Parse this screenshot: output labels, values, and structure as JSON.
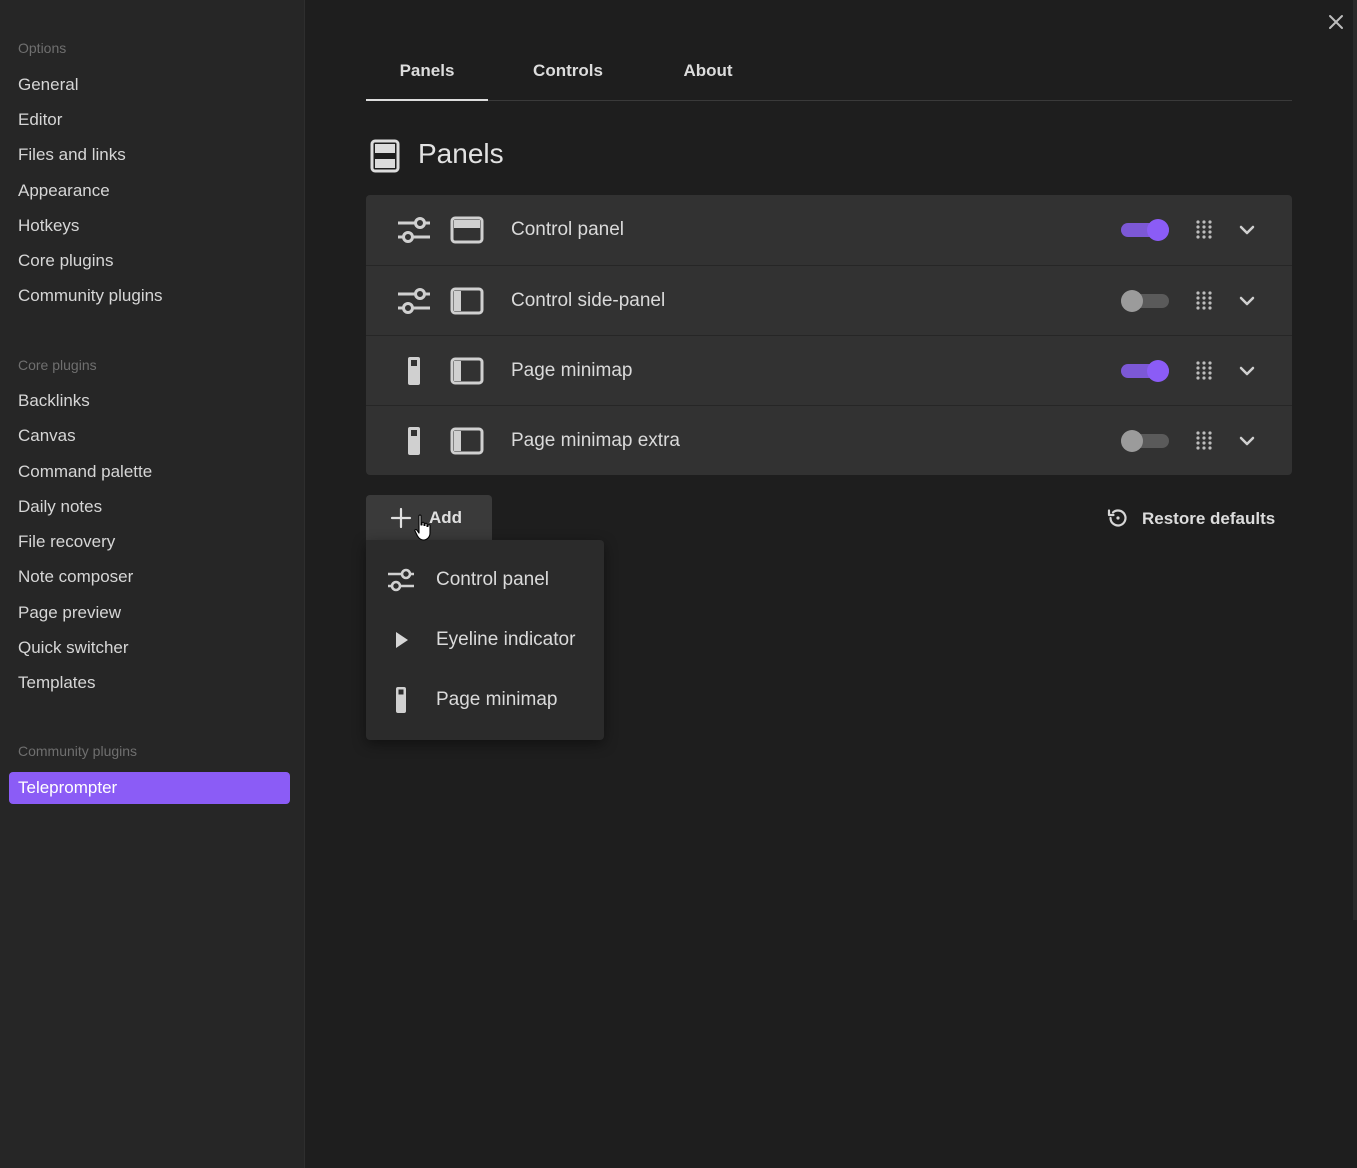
{
  "sidebar": {
    "options_title": "Options",
    "options": [
      {
        "label": "General"
      },
      {
        "label": "Editor"
      },
      {
        "label": "Files and links"
      },
      {
        "label": "Appearance"
      },
      {
        "label": "Hotkeys"
      },
      {
        "label": "Core plugins"
      },
      {
        "label": "Community plugins"
      }
    ],
    "core_title": "Core plugins",
    "core": [
      {
        "label": "Backlinks"
      },
      {
        "label": "Canvas"
      },
      {
        "label": "Command palette"
      },
      {
        "label": "Daily notes"
      },
      {
        "label": "File recovery"
      },
      {
        "label": "Note composer"
      },
      {
        "label": "Page preview"
      },
      {
        "label": "Quick switcher"
      },
      {
        "label": "Templates"
      }
    ],
    "community_title": "Community plugins",
    "community": [
      {
        "label": "Teleprompter",
        "active": true
      }
    ]
  },
  "tabs": [
    {
      "label": "Panels",
      "active": true
    },
    {
      "label": "Controls"
    },
    {
      "label": "About"
    }
  ],
  "section": {
    "title": "Panels",
    "icon": "panels-icon"
  },
  "panels": [
    {
      "label": "Control panel",
      "icon1": "sliders-icon",
      "icon2": "layout-top-icon",
      "enabled": true
    },
    {
      "label": "Control side-panel",
      "icon1": "sliders-icon",
      "icon2": "layout-left-icon",
      "enabled": false
    },
    {
      "label": "Page minimap",
      "icon1": "minimap-icon",
      "icon2": "layout-left-icon",
      "enabled": true
    },
    {
      "label": "Page minimap extra",
      "icon1": "minimap-icon",
      "icon2": "layout-left-icon",
      "enabled": false
    }
  ],
  "actions": {
    "add_label": "Add",
    "restore_label": "Restore defaults"
  },
  "add_menu": [
    {
      "label": "Control panel",
      "icon": "sliders-icon"
    },
    {
      "label": "Eyeline indicator",
      "icon": "play-icon"
    },
    {
      "label": "Page minimap",
      "icon": "minimap-icon"
    }
  ],
  "colors": {
    "accent": "#8b5cf6",
    "background": "#1e1e1e",
    "sidebar": "#262626"
  }
}
